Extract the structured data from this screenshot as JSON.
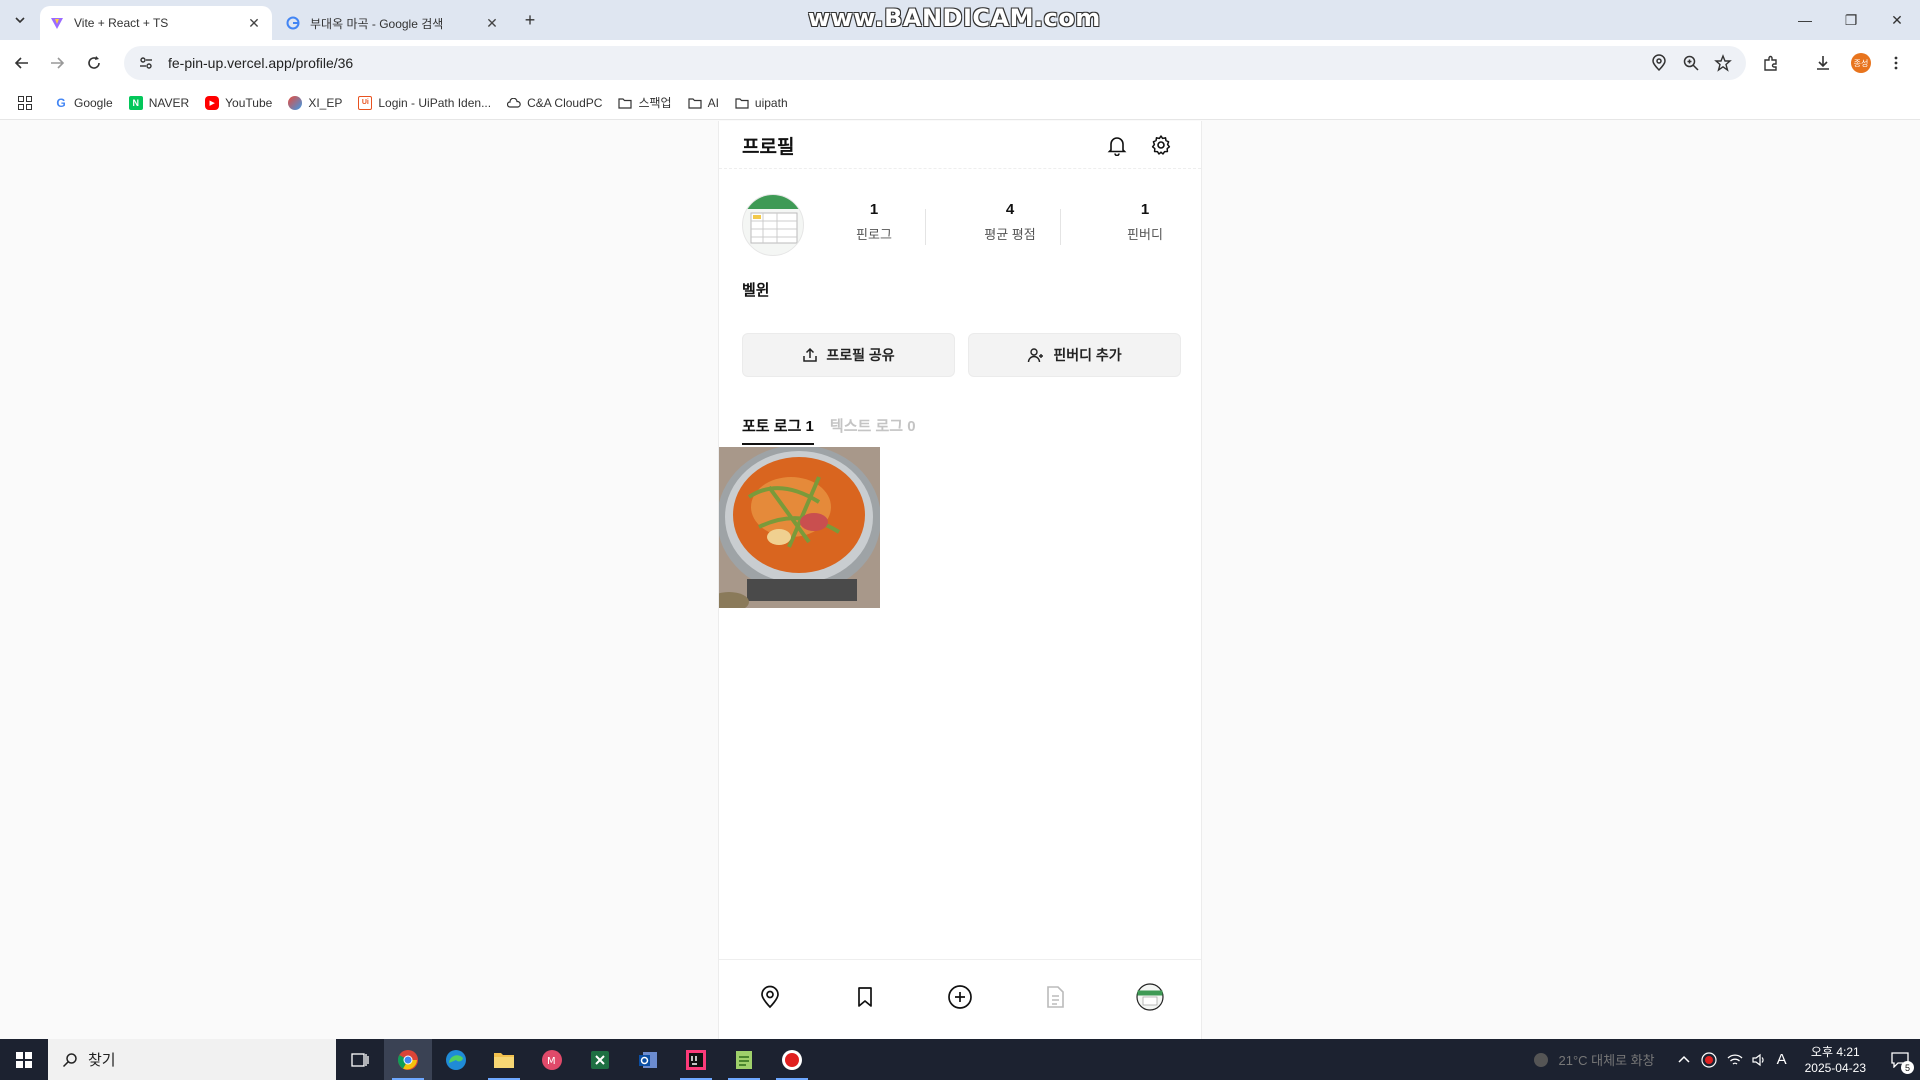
{
  "browser": {
    "tabs": [
      {
        "title": "Vite + React + TS",
        "active": true
      },
      {
        "title": "부대옥 마곡 - Google 검색",
        "active": false
      }
    ],
    "url": "fe-pin-up.vercel.app/profile/36",
    "profile_badge": "종성",
    "watermark": "www.BANDICAM.com",
    "bookmarks": [
      {
        "label": "Google",
        "icon": "google-icon"
      },
      {
        "label": "NAVER",
        "icon": "naver-icon"
      },
      {
        "label": "YouTube",
        "icon": "youtube-icon"
      },
      {
        "label": "XI_EP",
        "icon": "xi-ep-icon"
      },
      {
        "label": "Login - UiPath Iden...",
        "icon": "uipath-icon"
      },
      {
        "label": "C&A CloudPC",
        "icon": "cloud-icon"
      },
      {
        "label": "스팩업",
        "icon": "folder-icon"
      },
      {
        "label": "AI",
        "icon": "folder-icon"
      },
      {
        "label": "uipath",
        "icon": "folder-icon"
      }
    ]
  },
  "profile": {
    "title": "프로필",
    "stats": [
      {
        "value": "1",
        "label": "핀로그"
      },
      {
        "value": "4",
        "label": "평균 평점"
      },
      {
        "value": "1",
        "label": "핀버디"
      }
    ],
    "nickname": "벨윈",
    "share_button": "프로필 공유",
    "add_buddy_button": "핀버디 추가",
    "tabs": [
      {
        "label": "포토 로그",
        "count": "1",
        "active": true
      },
      {
        "label": "텍스트 로그",
        "count": "0",
        "active": false
      }
    ]
  },
  "taskbar": {
    "search_placeholder": "찾기",
    "weather": "21°C 대체로 화창",
    "time": "오후 4:21",
    "date": "2025-04-23",
    "ime": "A",
    "notification_count": "5"
  },
  "colors": {
    "accent": "#111111",
    "inactive_tab": "#c4c4c4",
    "taskbar": "#1c2230"
  }
}
